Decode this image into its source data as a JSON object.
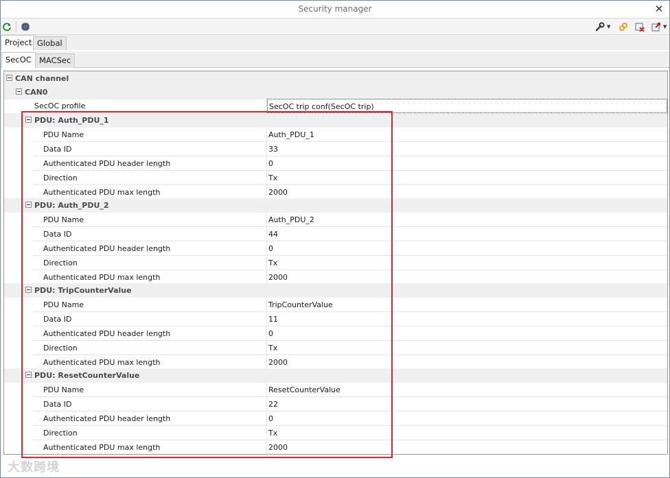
{
  "window": {
    "title": "Security manager"
  },
  "icons": {
    "close": "close-icon",
    "refresh": "refresh-icon",
    "chip": "chip-icon",
    "wrench": "wrench-icon",
    "link": "link-icon",
    "delete": "delete-icon",
    "export": "export-icon"
  },
  "colors": {
    "highlight": "#d9282f",
    "category_bg": "#f0f0f0"
  },
  "tabs_top": {
    "project": "Project",
    "global": "Global"
  },
  "tabs_sub": {
    "secoc": "SecOC",
    "macsec": "MACSec"
  },
  "tree": {
    "can_channel": "CAN channel",
    "can0": "CAN0",
    "secoc_profile": {
      "name": "SecOC profile",
      "value": "SecOC trip conf(SecOC trip)"
    },
    "pdus": [
      {
        "title": "PDU: Auth_PDU_1",
        "props": [
          {
            "name": "PDU Name",
            "value": "Auth_PDU_1"
          },
          {
            "name": "Data ID",
            "value": "33"
          },
          {
            "name": "Authenticated PDU header length",
            "value": "0"
          },
          {
            "name": "Direction",
            "value": "Tx"
          },
          {
            "name": "Authenticated PDU max length",
            "value": "2000"
          }
        ]
      },
      {
        "title": "PDU: Auth_PDU_2",
        "props": [
          {
            "name": "PDU Name",
            "value": "Auth_PDU_2"
          },
          {
            "name": "Data ID",
            "value": "44"
          },
          {
            "name": "Authenticated PDU header length",
            "value": "0"
          },
          {
            "name": "Direction",
            "value": "Tx"
          },
          {
            "name": "Authenticated PDU max length",
            "value": "2000"
          }
        ]
      },
      {
        "title": "PDU: TripCounterValue",
        "props": [
          {
            "name": "PDU Name",
            "value": "TripCounterValue"
          },
          {
            "name": "Data ID",
            "value": "11"
          },
          {
            "name": "Authenticated PDU header length",
            "value": "0"
          },
          {
            "name": "Direction",
            "value": "Tx"
          },
          {
            "name": "Authenticated PDU max length",
            "value": "2000"
          }
        ]
      },
      {
        "title": "PDU: ResetCounterValue",
        "props": [
          {
            "name": "PDU Name",
            "value": "ResetCounterValue"
          },
          {
            "name": "Data ID",
            "value": "22"
          },
          {
            "name": "Authenticated PDU header length",
            "value": "0"
          },
          {
            "name": "Direction",
            "value": "Tx"
          },
          {
            "name": "Authenticated PDU max length",
            "value": "2000"
          }
        ]
      }
    ]
  },
  "watermark": "大数跨境"
}
